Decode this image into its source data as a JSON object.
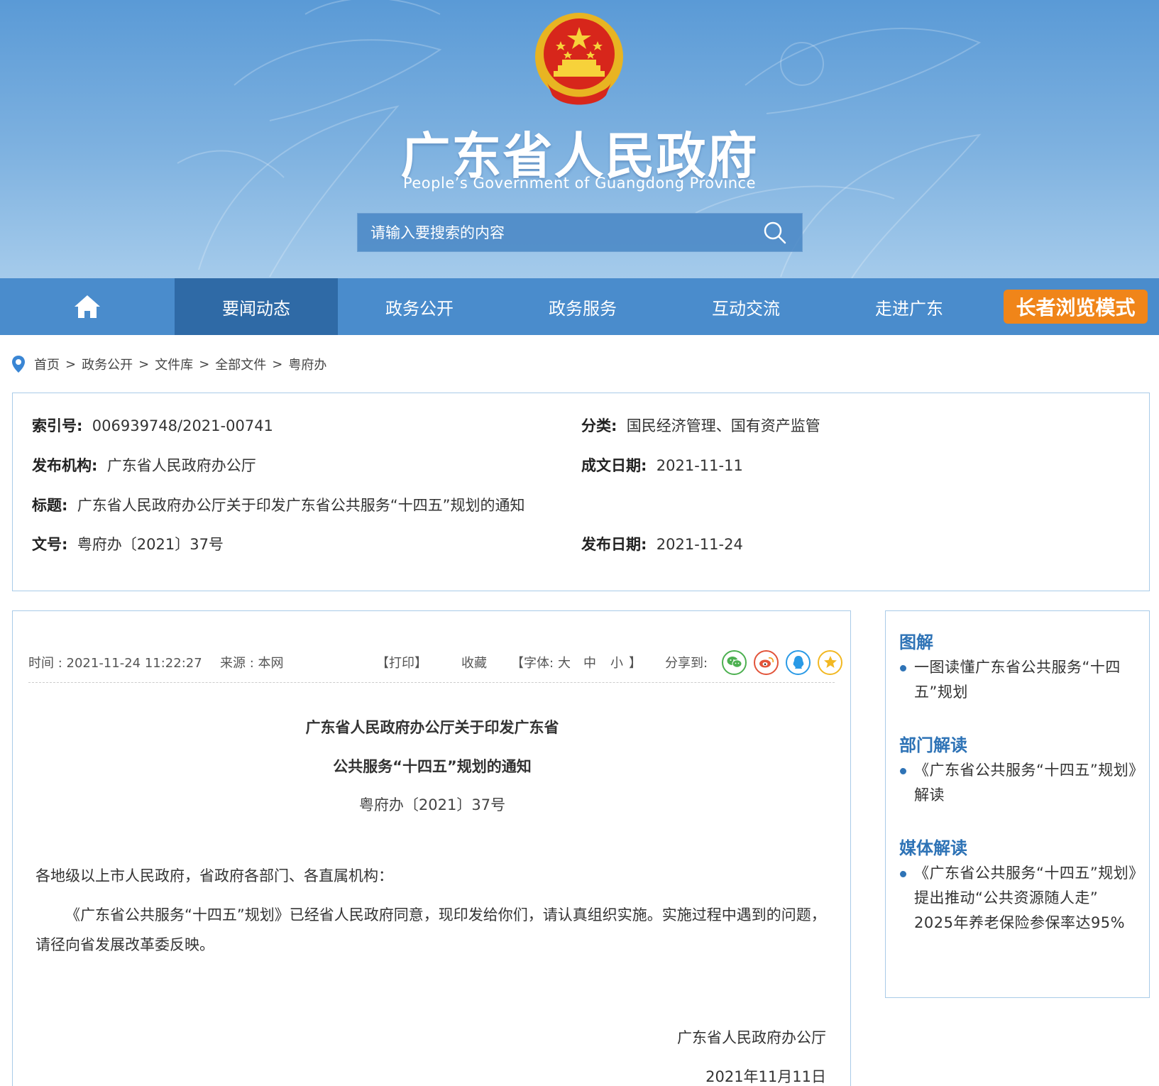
{
  "header": {
    "title": "广东省人民政府",
    "subtitle": "People’s Government of Guangdong Province",
    "search_placeholder": "请输入要搜索的内容"
  },
  "nav": {
    "items": [
      "要闻动态",
      "政务公开",
      "政务服务",
      "互动交流",
      "走进广东"
    ],
    "active_index": 0,
    "elder_mode": "长者浏览模式"
  },
  "breadcrumb": [
    "首页",
    "政务公开",
    "文件库",
    "全部文件",
    "粤府办"
  ],
  "meta": {
    "index_label": "索引号:",
    "index_value": "006939748/2021-00741",
    "category_label": "分类:",
    "category_value": "国民经济管理、国有资产监管",
    "issuer_label": "发布机构:",
    "issuer_value": "广东省人民政府办公厅",
    "written_date_label": "成文日期:",
    "written_date_value": "2021-11-11",
    "title_label": "标题:",
    "title_value": "广东省人民政府办公厅关于印发广东省公共服务“十四五”规划的通知",
    "doc_no_label": "文号:",
    "doc_no_value": "粤府办〔2021〕37号",
    "publish_date_label": "发布日期:",
    "publish_date_value": "2021-11-24"
  },
  "article": {
    "time": "时间 : 2021-11-24 11:22:27",
    "source": "来源 : 本网",
    "print": "【打印】",
    "favorite": "收藏",
    "font_label": "【字体:",
    "font_large": "大",
    "font_medium": "中",
    "font_small": "小",
    "font_close": "】",
    "share_label": "分享到:",
    "title_line1": "广东省人民政府办公厅关于印发广东省",
    "title_line2": "公共服务“十四五”规划的通知",
    "doc_number": "粤府办〔2021〕37号",
    "salutation": "各地级以上市人民政府，省政府各部门、各直属机构：",
    "body": "《广东省公共服务“十四五”规划》已经省人民政府同意，现印发给你们，请认真组织实施。实施过程中遇到的问题，请径向省发展改革委反映。",
    "signature": "广东省人民政府办公厅",
    "date": "2021年11月11日"
  },
  "sidebar": {
    "sections": [
      {
        "heading": "图解",
        "item": "一图读懂广东省公共服务“十四五”规划"
      },
      {
        "heading": "部门解读",
        "item": "《广东省公共服务“十四五”规划》解读"
      },
      {
        "heading": "媒体解读",
        "item": "《广东省公共服务“十四五”规划》提出推动“公共资源随人走” 2025年养老保险参保率达95%"
      }
    ]
  },
  "colors": {
    "nav": "#4a8ccc",
    "nav_active": "#2f6aa6",
    "elder_button": "#f08519",
    "accent": "#2e73b6",
    "wechat": "#4cb050",
    "weibo": "#e2543a",
    "qq": "#2a9ae6",
    "qzone": "#f2b822"
  },
  "icons": [
    "home-icon",
    "search-icon",
    "location-pin-icon",
    "wechat-icon",
    "weibo-icon",
    "qq-icon",
    "qzone-star-icon",
    "national-emblem"
  ]
}
